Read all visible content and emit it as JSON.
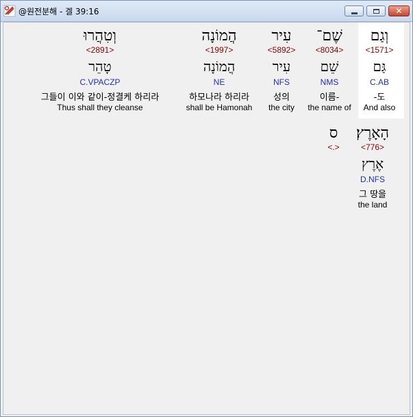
{
  "window": {
    "title": "@원전분해 - 겔 39:16",
    "buttons": {
      "minimize": "minimize",
      "maximize": "maximize",
      "close": "✕"
    }
  },
  "words": [
    {
      "hebrew": "וְגַם",
      "strong": "<1571>",
      "lemma": "גַּם",
      "morph": "C.AB",
      "korean": "-도",
      "english": "And also"
    },
    {
      "hebrew": "שֶׁם־",
      "strong": "<8034>",
      "lemma": "שֵׁם",
      "morph": "NMS",
      "korean": "이름-",
      "english": "the name of"
    },
    {
      "hebrew": "עִיר",
      "strong": "<5892>",
      "lemma": "עִיר",
      "morph": "NFS",
      "korean": "성의",
      "english": "the city"
    },
    {
      "hebrew": "הֲמוֹנָה",
      "strong": "<1997>",
      "lemma": "הֲמוֹנָה",
      "morph": "NE",
      "korean": "하모나라 하리라",
      "english": "shall be Hamonah"
    },
    {
      "hebrew": "וְטִהֲרוּ",
      "strong": "<2891>",
      "lemma": "טָהֵר",
      "morph": "C.VPACZP",
      "korean": "그들이 이와 같이-정결케 하리라",
      "english": "Thus shall they cleanse"
    },
    {
      "hebrew": "הָאָרֶץ׃",
      "strong": "<776>",
      "lemma": "אֶרֶץ",
      "morph": "D.NFS",
      "korean": "그 땅을",
      "english": "the land"
    },
    {
      "hebrew": "ס",
      "strong": "<.>",
      "lemma": "",
      "morph": "",
      "korean": "",
      "english": ""
    }
  ]
}
